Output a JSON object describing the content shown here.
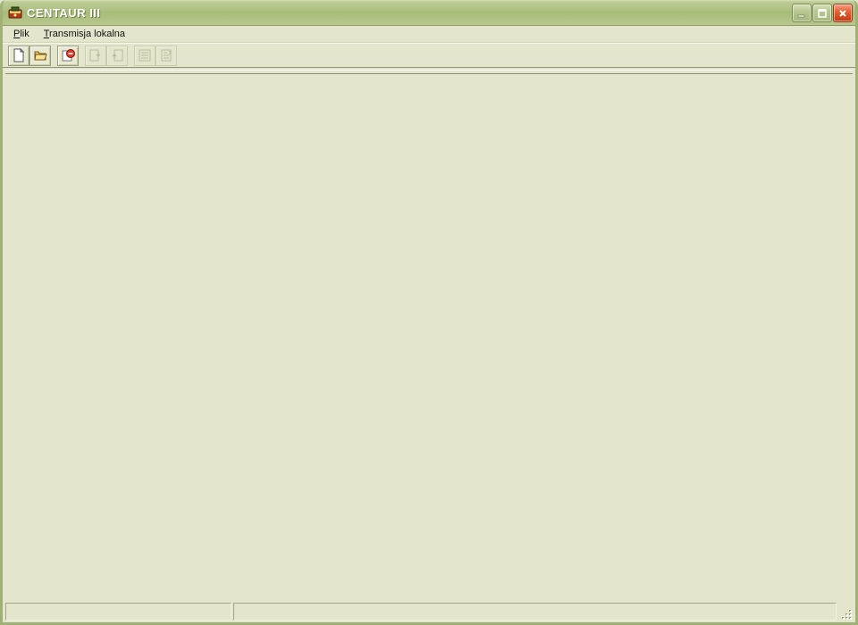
{
  "window": {
    "title": "CENTAUR III"
  },
  "menubar": {
    "items": [
      {
        "label": "Plik"
      },
      {
        "label": "Transmisja lokalna"
      }
    ]
  },
  "toolbar": {
    "buttons": [
      {
        "name": "new-file-icon",
        "enabled": true
      },
      {
        "name": "open-file-icon",
        "enabled": true
      },
      {
        "name": "stop-transfer-icon",
        "enabled": true
      },
      {
        "name": "receive-down-icon",
        "enabled": false
      },
      {
        "name": "send-up-icon",
        "enabled": false
      },
      {
        "name": "settings-list-icon",
        "enabled": false
      },
      {
        "name": "report-icon",
        "enabled": false
      }
    ]
  },
  "statusbar": {
    "pane1": "",
    "pane2": ""
  }
}
